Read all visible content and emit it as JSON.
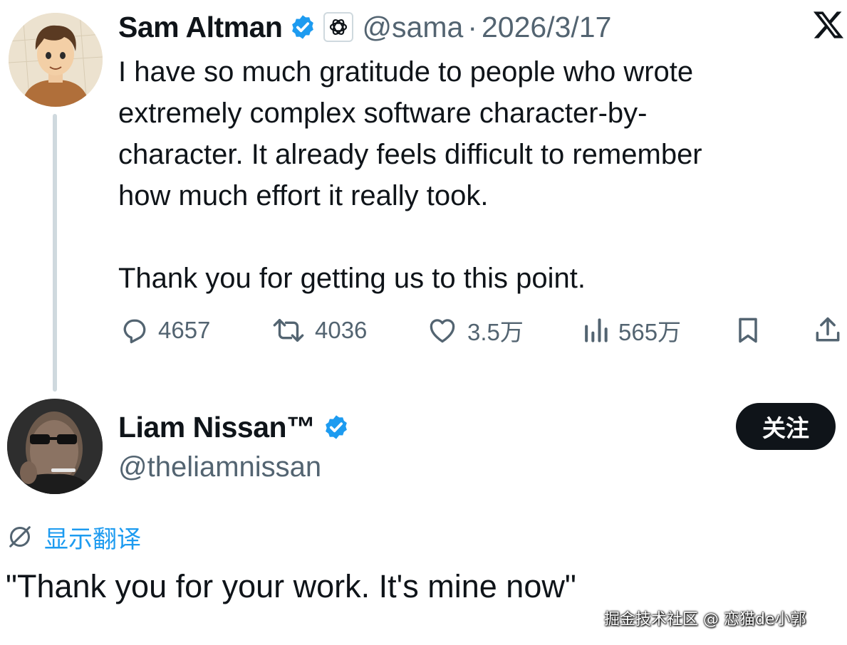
{
  "colors": {
    "text_primary": "#0f1419",
    "text_secondary": "#536471",
    "verified_blue": "#1d9bf0",
    "follow_button_bg": "#0f1419",
    "thread_line": "#cfd9de"
  },
  "tweet": {
    "author_name": "Sam Altman",
    "verified_icon": "verified-badge-icon",
    "affiliation_icon": "openai-logo-icon",
    "handle": "@sama",
    "separator": "·",
    "date": "2026/3/17",
    "platform_icon": "x-logo-icon",
    "body": [
      "I have so much gratitude to people who wrote",
      "extremely complex software character-by-",
      "character. It already feels difficult to remember",
      "how much effort it really took."
    ],
    "body2": "Thank you for getting us to this point.",
    "actions": {
      "replies": "4657",
      "reposts": "4036",
      "likes": "3.5万",
      "views": "565万"
    }
  },
  "reply": {
    "author_name": "Liam Nissan™",
    "verified_icon": "verified-badge-icon",
    "handle": "@theliamnissan",
    "follow_label": "关注",
    "translate_label": "显示翻译",
    "text": "\"Thank you for your work. It's mine now\""
  },
  "watermark": "掘金技术社区 @ 恋猫de小郭"
}
